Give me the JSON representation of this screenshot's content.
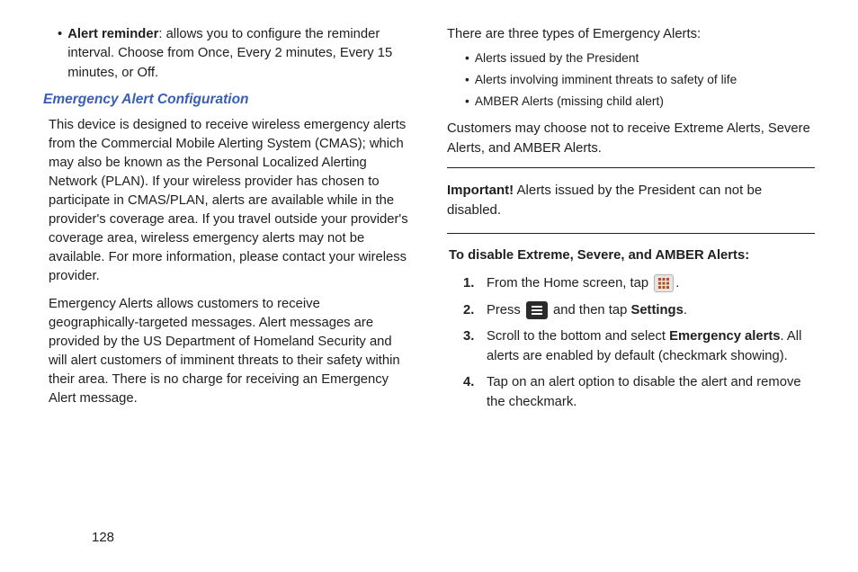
{
  "left": {
    "alert_reminder_term": "Alert reminder",
    "alert_reminder_desc": ": allows you to configure the reminder interval. Choose from Once, Every 2 minutes, Every 15 minutes, or Off.",
    "subhead": "Emergency Alert Configuration",
    "para1": "This device is designed to receive wireless emergency alerts from the Commercial Mobile Alerting System (CMAS); which may also be known as the Personal Localized Alerting Network (PLAN). If your wireless provider has chosen to participate in CMAS/PLAN, alerts are available while in the provider's coverage area. If you travel outside your provider's coverage area, wireless emergency alerts may not be available. For more information, please contact your wireless provider.",
    "para2": "Emergency Alerts allows customers to receive geographically-targeted messages. Alert messages are provided by the US Department of Homeland Security and will alert customers of imminent threats to their safety within their area. There is no charge for receiving an Emergency Alert message."
  },
  "right": {
    "intro": "There are three types of Emergency Alerts:",
    "types": [
      "Alerts issued by the President",
      "Alerts involving imminent threats to safety of life",
      "AMBER Alerts (missing child alert)"
    ],
    "optout": "Customers may choose not to receive Extreme Alerts, Severe Alerts, and AMBER Alerts.",
    "important_label": "Important!",
    "important_text": " Alerts issued by the President can not be disabled.",
    "disable_heading": "To disable Extreme, Severe, and AMBER Alerts:",
    "step1_a": "From the Home screen, tap ",
    "step1_b": ".",
    "step2_a": "Press ",
    "step2_b": " and then tap ",
    "step2_settings": "Settings",
    "step2_c": ".",
    "step3_a": "Scroll to the bottom and select ",
    "step3_em": "Emergency alerts",
    "step3_b": ". All alerts are enabled by default (checkmark showing).",
    "step4": "Tap on an alert option to disable the alert and remove the checkmark."
  },
  "page_number": "128"
}
